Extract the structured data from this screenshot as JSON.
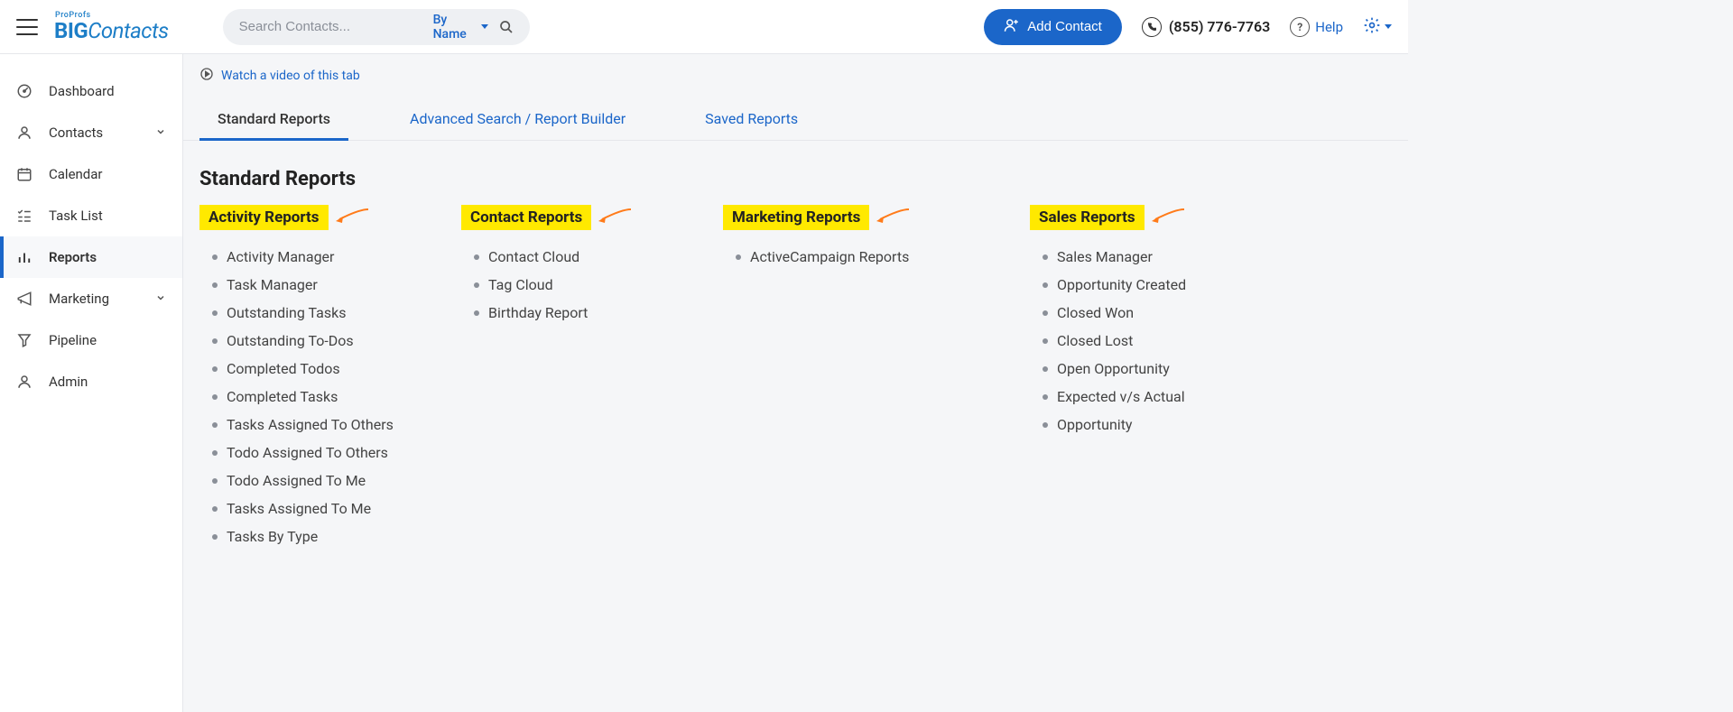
{
  "header": {
    "logo_small": "ProProfs",
    "logo_big": "BIG",
    "logo_rest": "Contacts",
    "search_placeholder": "Search Contacts...",
    "search_filter": "By Name",
    "add_contact": "Add Contact",
    "phone": "(855) 776-7763",
    "help": "Help"
  },
  "sidebar": {
    "items": [
      {
        "label": "Dashboard"
      },
      {
        "label": "Contacts"
      },
      {
        "label": "Calendar"
      },
      {
        "label": "Task List"
      },
      {
        "label": "Reports"
      },
      {
        "label": "Marketing"
      },
      {
        "label": "Pipeline"
      },
      {
        "label": "Admin"
      }
    ]
  },
  "video_link": "Watch a video of this tab",
  "tabs": {
    "standard": "Standard Reports",
    "advanced": "Advanced Search / Report Builder",
    "saved": "Saved Reports"
  },
  "page_title": "Standard Reports",
  "columns": {
    "activity": {
      "title": "Activity Reports",
      "items": [
        "Activity Manager",
        "Task Manager",
        "Outstanding Tasks",
        "Outstanding To-Dos",
        "Completed Todos",
        "Completed Tasks",
        "Tasks Assigned To Others",
        "Todo Assigned To Others",
        "Todo Assigned To Me",
        "Tasks Assigned To Me",
        "Tasks By Type"
      ]
    },
    "contact": {
      "title": "Contact Reports",
      "items": [
        "Contact Cloud",
        "Tag Cloud",
        "Birthday Report"
      ]
    },
    "marketing": {
      "title": "Marketing Reports",
      "items": [
        "ActiveCampaign Reports"
      ]
    },
    "sales": {
      "title": "Sales Reports",
      "items": [
        "Sales Manager",
        "Opportunity Created",
        "Closed Won",
        "Closed Lost",
        "Open Opportunity",
        "Expected v/s Actual",
        "Opportunity"
      ]
    }
  }
}
